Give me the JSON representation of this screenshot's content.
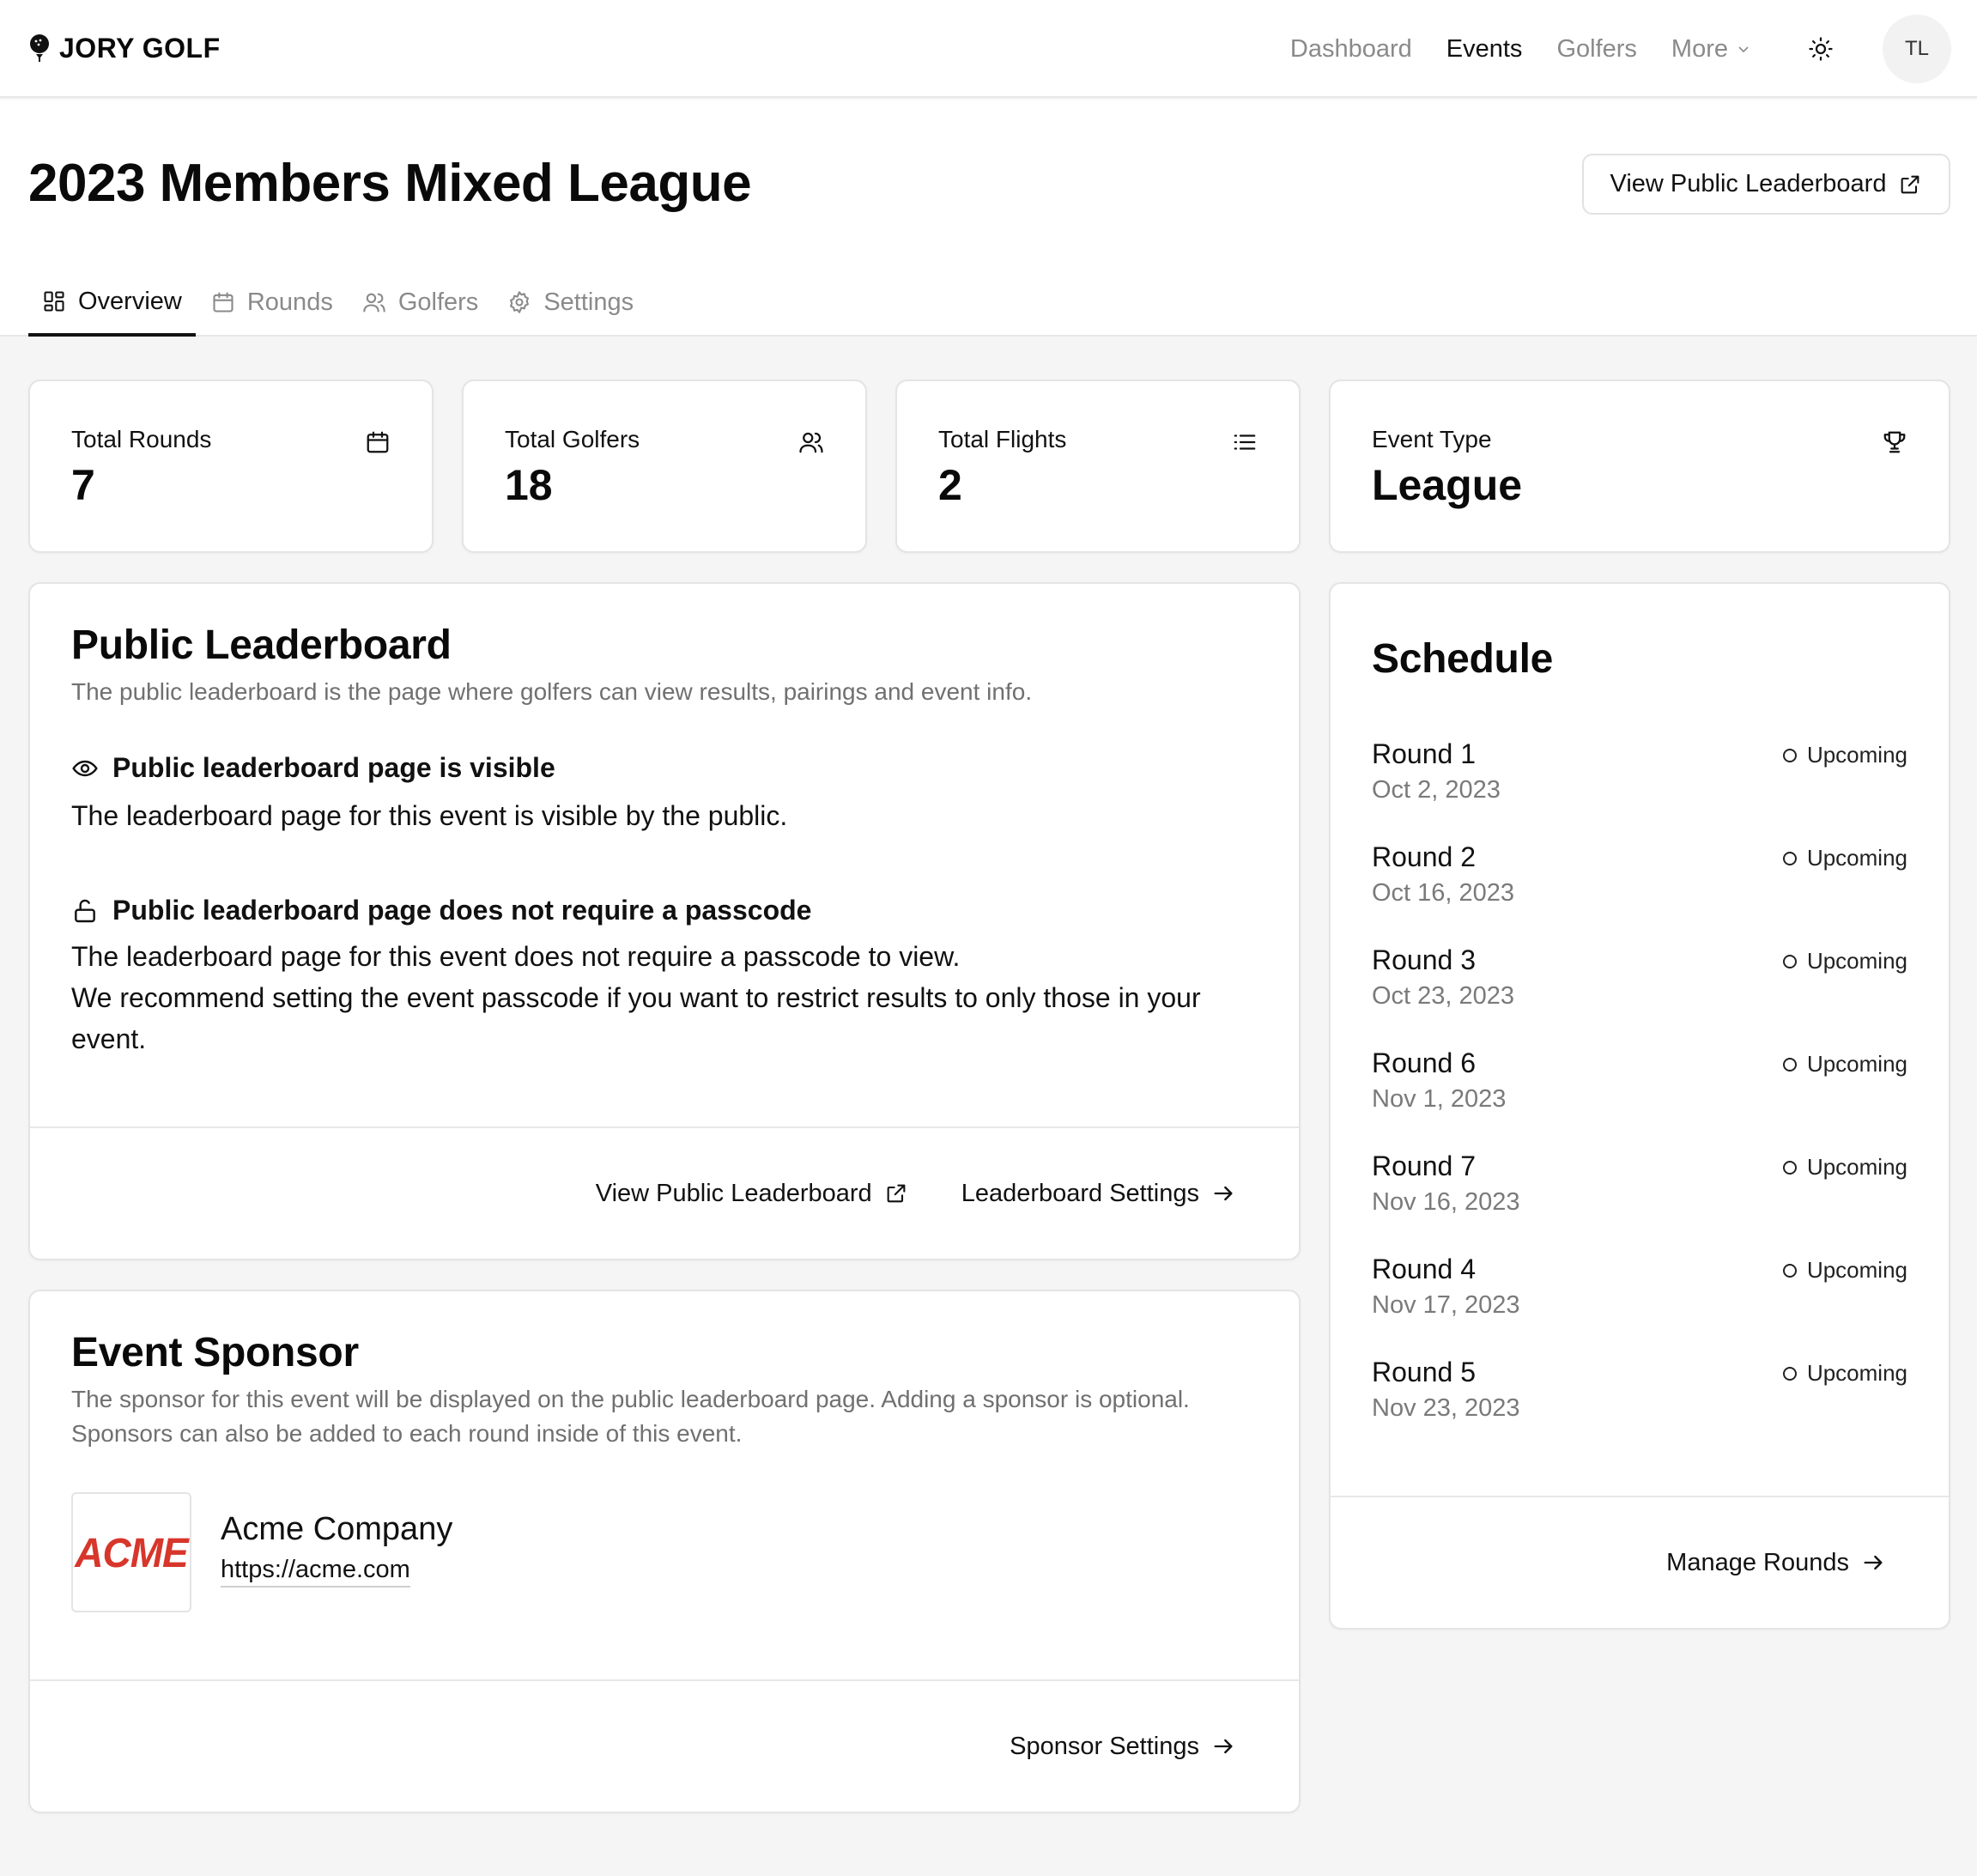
{
  "brand": {
    "name": "JORY GOLF"
  },
  "nav": {
    "dashboard": "Dashboard",
    "events": "Events",
    "golfers": "Golfers",
    "more": "More",
    "avatar_initials": "TL"
  },
  "header": {
    "title": "2023 Members Mixed League",
    "public_button": "View Public Leaderboard",
    "tabs": {
      "overview": "Overview",
      "rounds": "Rounds",
      "golfers": "Golfers",
      "settings": "Settings"
    }
  },
  "stats": {
    "rounds": {
      "label": "Total Rounds",
      "value": "7"
    },
    "golfers": {
      "label": "Total Golfers",
      "value": "18"
    },
    "flights": {
      "label": "Total Flights",
      "value": "2"
    },
    "event_type": {
      "label": "Event Type",
      "value": "League"
    }
  },
  "leaderboard": {
    "title": "Public Leaderboard",
    "description": "The public leaderboard is the page where golfers can view results, pairings and event info.",
    "visible_head": "Public leaderboard page is visible",
    "visible_body": "The leaderboard page for this event is visible by the public.",
    "passcode_head": "Public leaderboard page does not require a passcode",
    "passcode_body_1": "The leaderboard page for this event does not require a passcode to view.",
    "passcode_body_2": "We recommend setting the event passcode if you want to restrict results to only those in your event.",
    "view_link": "View Public Leaderboard",
    "settings_link": "Leaderboard Settings"
  },
  "sponsor": {
    "title": "Event Sponsor",
    "description": "The sponsor for this event will be displayed on the public leaderboard page. Adding a sponsor is optional. Sponsors can also be added to each round inside of this event.",
    "logo_text": "ACME",
    "name": "Acme Company",
    "url": "https://acme.com",
    "settings_link": "Sponsor Settings"
  },
  "schedule": {
    "title": "Schedule",
    "rounds": [
      {
        "name": "Round 1",
        "date": "Oct 2, 2023",
        "status": "Upcoming"
      },
      {
        "name": "Round 2",
        "date": "Oct 16, 2023",
        "status": "Upcoming"
      },
      {
        "name": "Round 3",
        "date": "Oct 23, 2023",
        "status": "Upcoming"
      },
      {
        "name": "Round 6",
        "date": "Nov 1, 2023",
        "status": "Upcoming"
      },
      {
        "name": "Round 7",
        "date": "Nov 16, 2023",
        "status": "Upcoming"
      },
      {
        "name": "Round 4",
        "date": "Nov 17, 2023",
        "status": "Upcoming"
      },
      {
        "name": "Round 5",
        "date": "Nov 23, 2023",
        "status": "Upcoming"
      }
    ],
    "manage_link": "Manage Rounds"
  },
  "colors": {
    "accent": "#111111",
    "muted": "#8a8a8a",
    "sponsor_logo": "#d7362b"
  },
  "icons": [
    "golf-ball-icon",
    "chevron-down-icon",
    "sun-icon",
    "external-link-icon",
    "overview-grid-icon",
    "calendar-icon",
    "users-icon",
    "gear-icon",
    "list-icon",
    "trophy-icon",
    "eye-icon",
    "lock-open-icon",
    "arrow-right-icon"
  ]
}
